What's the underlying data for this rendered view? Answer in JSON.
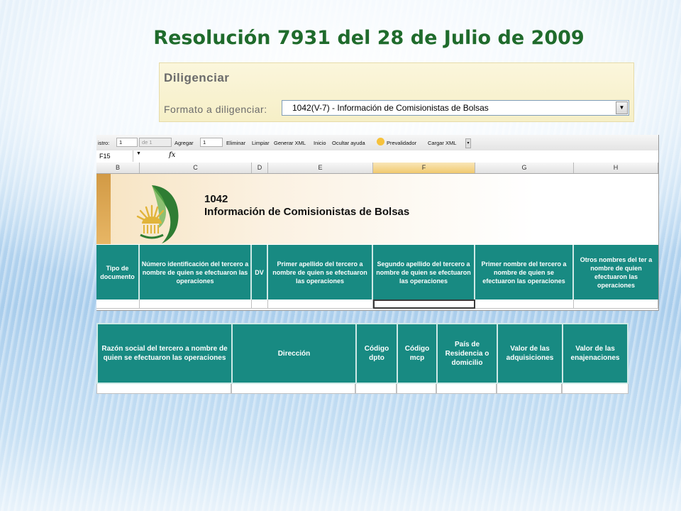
{
  "slide": {
    "title": "Resolución 7931 del 28 de Julio de 2009"
  },
  "diligenciar": {
    "title": "Diligenciar",
    "format_label": "Formato a diligenciar:",
    "format_value": "1042(V-7) - Información de Comisionistas de Bolsas",
    "arrow": "▼"
  },
  "toolbar": {
    "registro_label": "istro:",
    "registro_value": "1",
    "de_value": "de 1",
    "agregar_label": "Agregar",
    "agregar_value": "1",
    "eliminar": "Eliminar",
    "limpiar": "Limpiar",
    "generar_xml": "Generar XML",
    "inicio": "Inicio",
    "ocultar_ayuda": "Ocultar ayuda",
    "prevalidador": "Prevalidador",
    "cargar_xml": "Cargar XML",
    "more": "▾"
  },
  "formula_bar": {
    "cell_ref": "F15",
    "dropdown": "▼",
    "fx": "fx"
  },
  "columns": [
    "B",
    "C",
    "D",
    "E",
    "F",
    "G",
    "H"
  ],
  "selected_column": "F",
  "banner": {
    "code": "1042",
    "name": "Información de Comisionistas de Bolsas"
  },
  "table1_headers": [
    "Tipo de documento",
    "Número identificación del tercero a nombre de quien se efectuaron las operaciones",
    "DV",
    "Primer apellido del tercero a nombre de quien se efectuaron las operaciones",
    "Segundo apellido del tercero a nombre de quien se efectuaron las operaciones",
    "Primer nombre del tercero a nombre de quien se efectuaron las operaciones",
    "Otros nombres del ter a nombre de quien efectuaron las operaciones"
  ],
  "table2_headers": [
    "Razón social del tercero a nombre de quien se efectuaron las operaciones",
    "Dirección",
    "Código dpto",
    "Código mcp",
    "País de Residencia o domicilio",
    "Valor de las adquisiciones",
    "Valor de las enajenaciones"
  ],
  "colors": {
    "title_green": "#1f6b2c",
    "header_teal": "#188a82",
    "panel_cream": "#f6efc7",
    "logo_green": "#2f7d33",
    "logo_gold": "#e1b43a"
  }
}
